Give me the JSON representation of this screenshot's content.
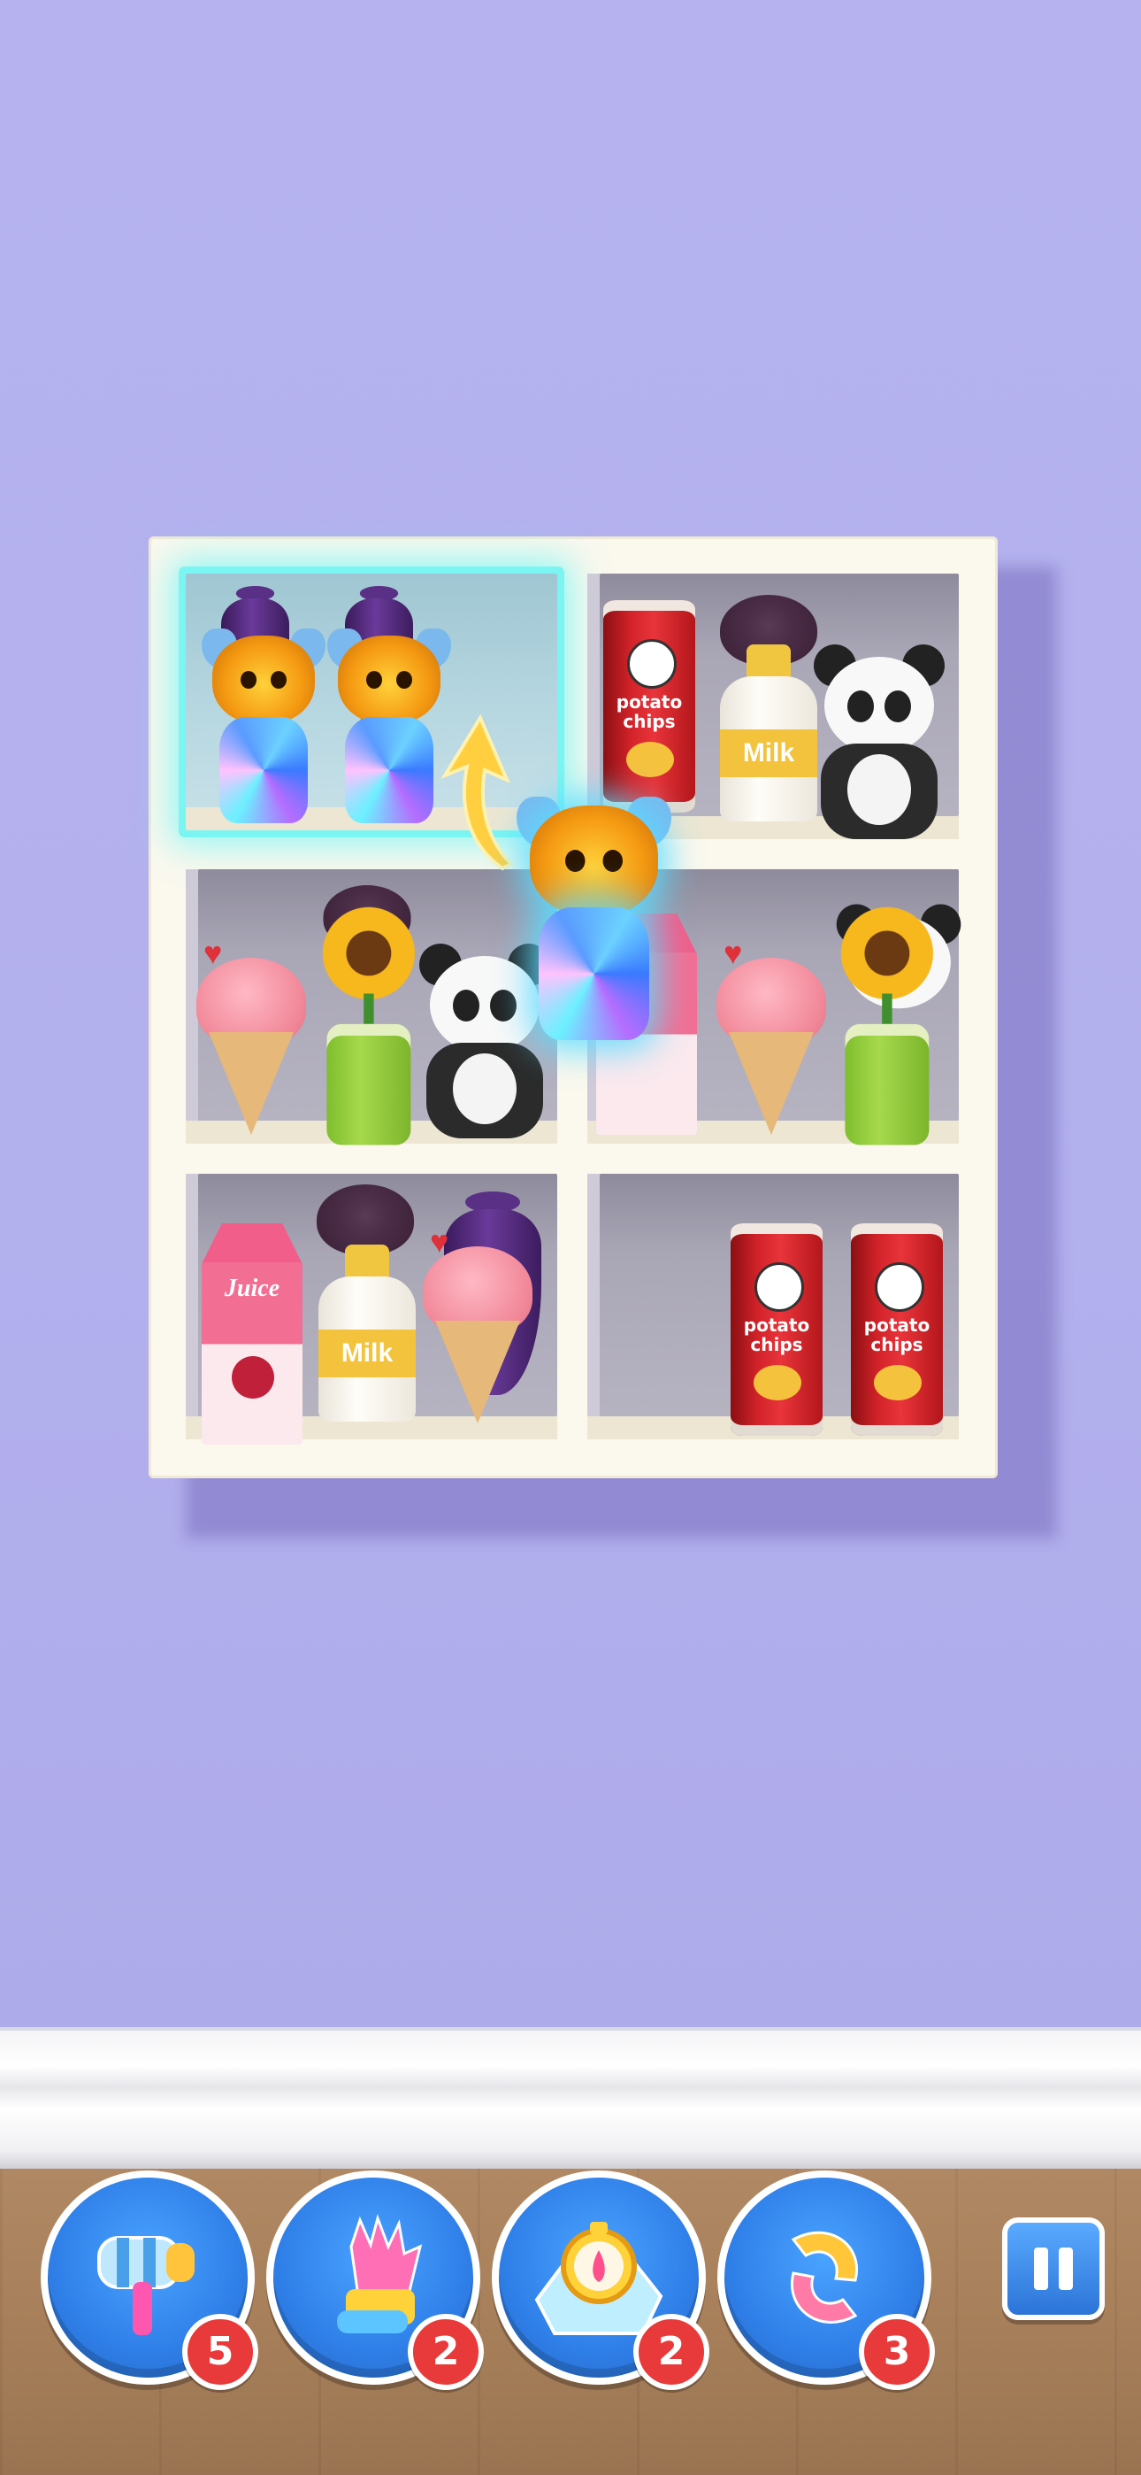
{
  "colors": {
    "wall": "#b5b2ef",
    "shelf": "#fbf8ee",
    "highlight": "#7af5f2",
    "booster_blue": "#2f7fe8",
    "badge_red": "#e83a3a",
    "floor": "#a77f5a"
  },
  "shelf": {
    "cells": [
      {
        "items": [
          "crystal-dog",
          "crystal-dog"
        ],
        "highlighted": true
      },
      {
        "items": [
          "chips-can",
          "milk-bottle",
          "panda"
        ]
      },
      {
        "items": [
          "ice-cream",
          "sunflower-jar",
          "panda"
        ]
      },
      {
        "items": [
          "juice-carton",
          "ice-cream",
          "sunflower-jar"
        ]
      },
      {
        "items": [
          "juice-carton",
          "milk-bottle",
          "ice-cream"
        ]
      },
      {
        "items": [
          "chips-can",
          "chips-can"
        ]
      }
    ],
    "labels": {
      "chips": "potato chips",
      "milk": "Milk",
      "juice": "Juice"
    },
    "moving_item": "crystal-dog"
  },
  "boosters": [
    {
      "name": "hammer",
      "icon": "hammer-icon",
      "count": "5"
    },
    {
      "name": "glove",
      "icon": "glove-icon",
      "count": "2"
    },
    {
      "name": "freeze",
      "icon": "frozen-clock-icon",
      "count": "2"
    },
    {
      "name": "shuffle",
      "icon": "shuffle-icon",
      "count": "3"
    }
  ],
  "pause": {
    "icon": "pause-icon"
  }
}
